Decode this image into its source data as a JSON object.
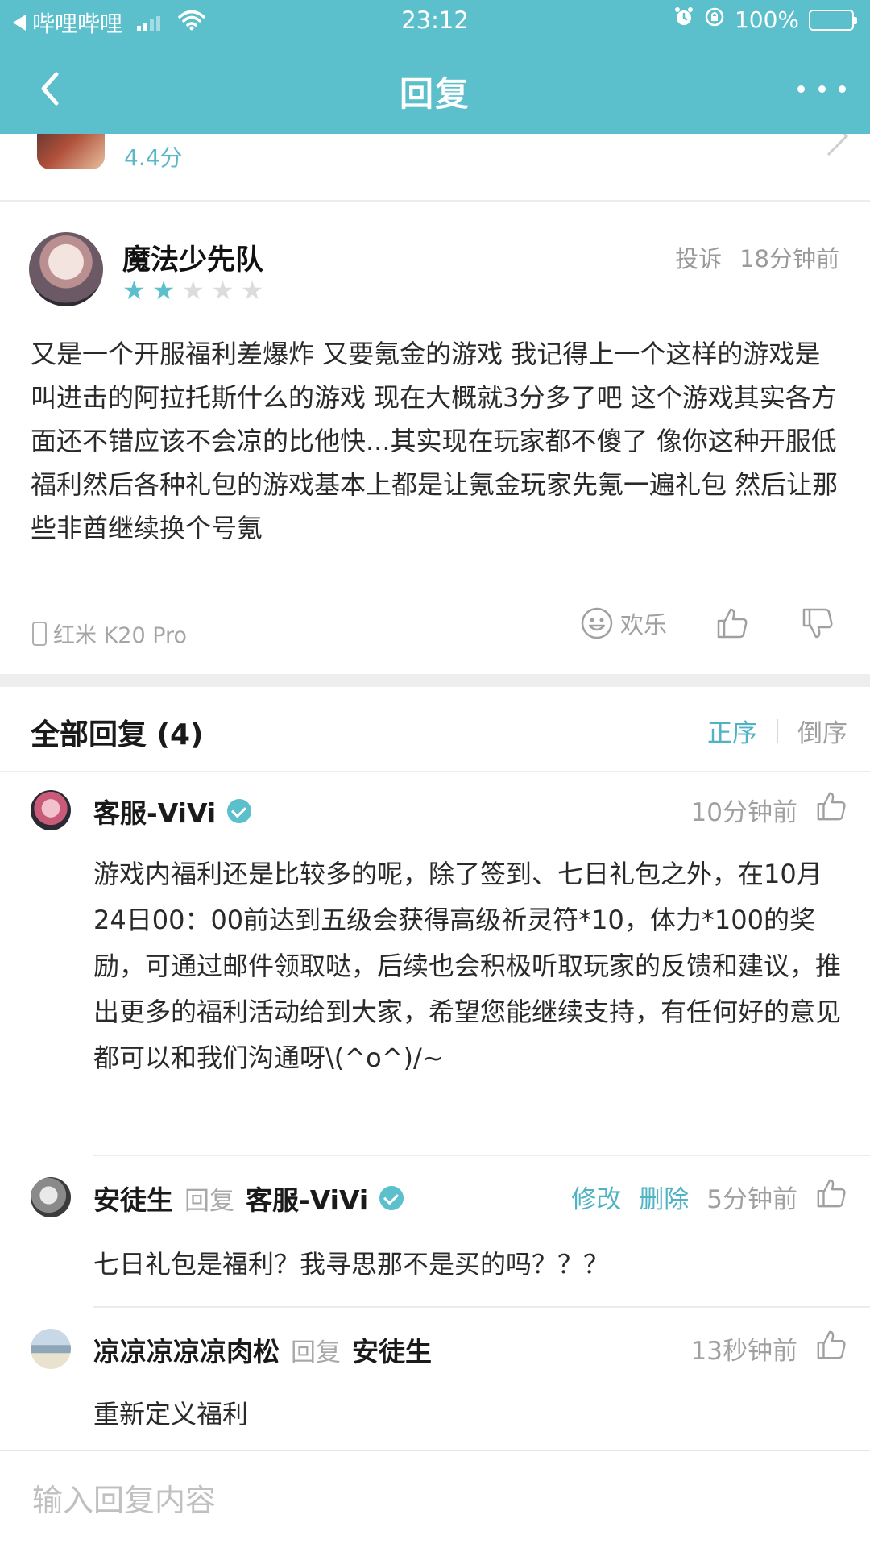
{
  "status_bar": {
    "carrier": "哔哩哔哩",
    "time": "23:12",
    "battery": "100%"
  },
  "header": {
    "title": "回复"
  },
  "game": {
    "rating": "4.4分"
  },
  "review": {
    "author": "魔法少先队",
    "stars": 2,
    "stars_total": 5,
    "report": "投诉",
    "time": "18分钟前",
    "body": "又是一个开服福利差爆炸 又要氪金的游戏 我记得上一个这样的游戏是叫进击的阿拉托斯什么的游戏 现在大概就3分多了吧  这个游戏其实各方面还不错应该不会凉的比他快...其实现在玩家都不傻了 像你这种开服低福利然后各种礼包的游戏基本上都是让氪金玩家先氪一遍礼包 然后让那些非酋继续换个号氪",
    "device": "红米 K20 Pro",
    "reaction": "欢乐"
  },
  "replies": {
    "title": "全部回复 (4)",
    "sort_asc": "正序",
    "sort_desc": "倒序",
    "items": [
      {
        "author": "客服-ViVi",
        "time": "10分钟前",
        "body": "游戏内福利还是比较多的呢，除了签到、七日礼包之外，在10月24日00：00前达到五级会获得高级祈灵符*10，体力*100的奖励，可通过邮件领取哒，后续也会积极听取玩家的反馈和建议，推出更多的福利活动给到大家，希望您能继续支持，有任何好的意见都可以和我们沟通呀\\(^o^)/~"
      },
      {
        "author": "安徒生",
        "reply_word": "回复",
        "reply_to": "客服-ViVi",
        "edit": "修改",
        "delete": "删除",
        "time": "5分钟前",
        "body": "七日礼包是福利？我寻思那不是买的吗？？？"
      },
      {
        "author": "凉凉凉凉凉肉松",
        "reply_word": "回复",
        "reply_to": "安徒生",
        "time": "13秒钟前",
        "body": "重新定义福利"
      }
    ]
  },
  "input": {
    "placeholder": "输入回复内容"
  },
  "colors": {
    "accent": "#5bbfcc",
    "link": "#4fb3c4",
    "muted": "#a0a0a0"
  }
}
